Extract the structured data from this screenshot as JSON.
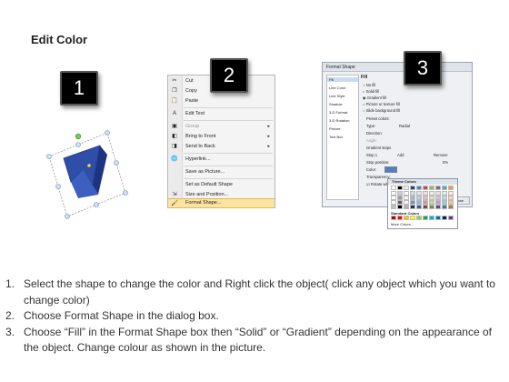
{
  "title": "Edit Color",
  "steps": {
    "badge1": "1",
    "badge2": "2",
    "badge3": "3"
  },
  "context_menu": {
    "items": [
      {
        "label": "Cut",
        "icon": "scissors-icon"
      },
      {
        "label": "Copy",
        "icon": "copy-icon"
      },
      {
        "label": "Paste",
        "icon": "paste-icon"
      },
      {
        "label": "Edit Text",
        "icon": "edit-text-icon"
      },
      {
        "label": "Group",
        "icon": "group-icon",
        "submenu": true
      },
      {
        "label": "Bring to Front",
        "icon": "bring-front-icon",
        "submenu": true
      },
      {
        "label": "Send to Back",
        "icon": "send-back-icon",
        "submenu": true
      },
      {
        "label": "Hyperlink...",
        "icon": "hyperlink-icon"
      },
      {
        "label": "Save as Picture...",
        "icon": ""
      },
      {
        "label": "Set as Default Shape",
        "icon": ""
      },
      {
        "label": "Size and Position...",
        "icon": "size-position-icon"
      },
      {
        "label": "Format Shape...",
        "icon": "format-shape-icon"
      }
    ]
  },
  "format_dialog": {
    "title": "Format Shape",
    "nav": [
      "Fill",
      "Line Color",
      "Line Style",
      "Shadow",
      "3-D Format",
      "3-D Rotation",
      "Picture",
      "Text Box"
    ],
    "section": "Fill",
    "options": [
      "No fill",
      "Solid fill",
      "Gradient fill",
      "Picture or texture fill",
      "Slide background fill"
    ],
    "fields": {
      "preset": "Preset colors:",
      "type": "Type:",
      "type_value": "Radial",
      "direction": "Direction:",
      "angle": "Angle:",
      "gradient_stops": "Gradient stops",
      "stop": "Stop 1",
      "add": "Add",
      "remove": "Remove",
      "stop_position": "Stop position:",
      "stop_value": "0%",
      "color": "Color:",
      "transparency": "Transparency:",
      "rotate": "Rotate with shape"
    },
    "close": "Close"
  },
  "color_picker": {
    "theme_header": "Theme Colors",
    "standard_header": "Standard Colors",
    "more": "More Colors...",
    "theme_top": [
      "#ffffff",
      "#000000",
      "#eeece1",
      "#1f497d",
      "#4f81bd",
      "#c0504d",
      "#9bbb59",
      "#8064a2",
      "#4bacc6",
      "#f79646"
    ],
    "standard": [
      "#c00000",
      "#ff0000",
      "#ffc000",
      "#ffff00",
      "#92d050",
      "#00b050",
      "#00b0f0",
      "#0070c0",
      "#002060",
      "#7030a0"
    ]
  },
  "instructions": [
    {
      "num": "1.",
      "text": "Select the shape to change the color and Right click the object( click any object which you want to change color)"
    },
    {
      "num": "2.",
      "text": "Choose Format Shape in the dialog box."
    },
    {
      "num": "3.",
      "text": "Choose “Fill” in the Format Shape box then “Solid” or “Gradient” depending on the appearance of the object. Change colour as shown in the picture."
    }
  ],
  "colors": {
    "shape_blue": "#2f4ea8",
    "highlight": "#fce3a3",
    "badge": "#000000"
  }
}
